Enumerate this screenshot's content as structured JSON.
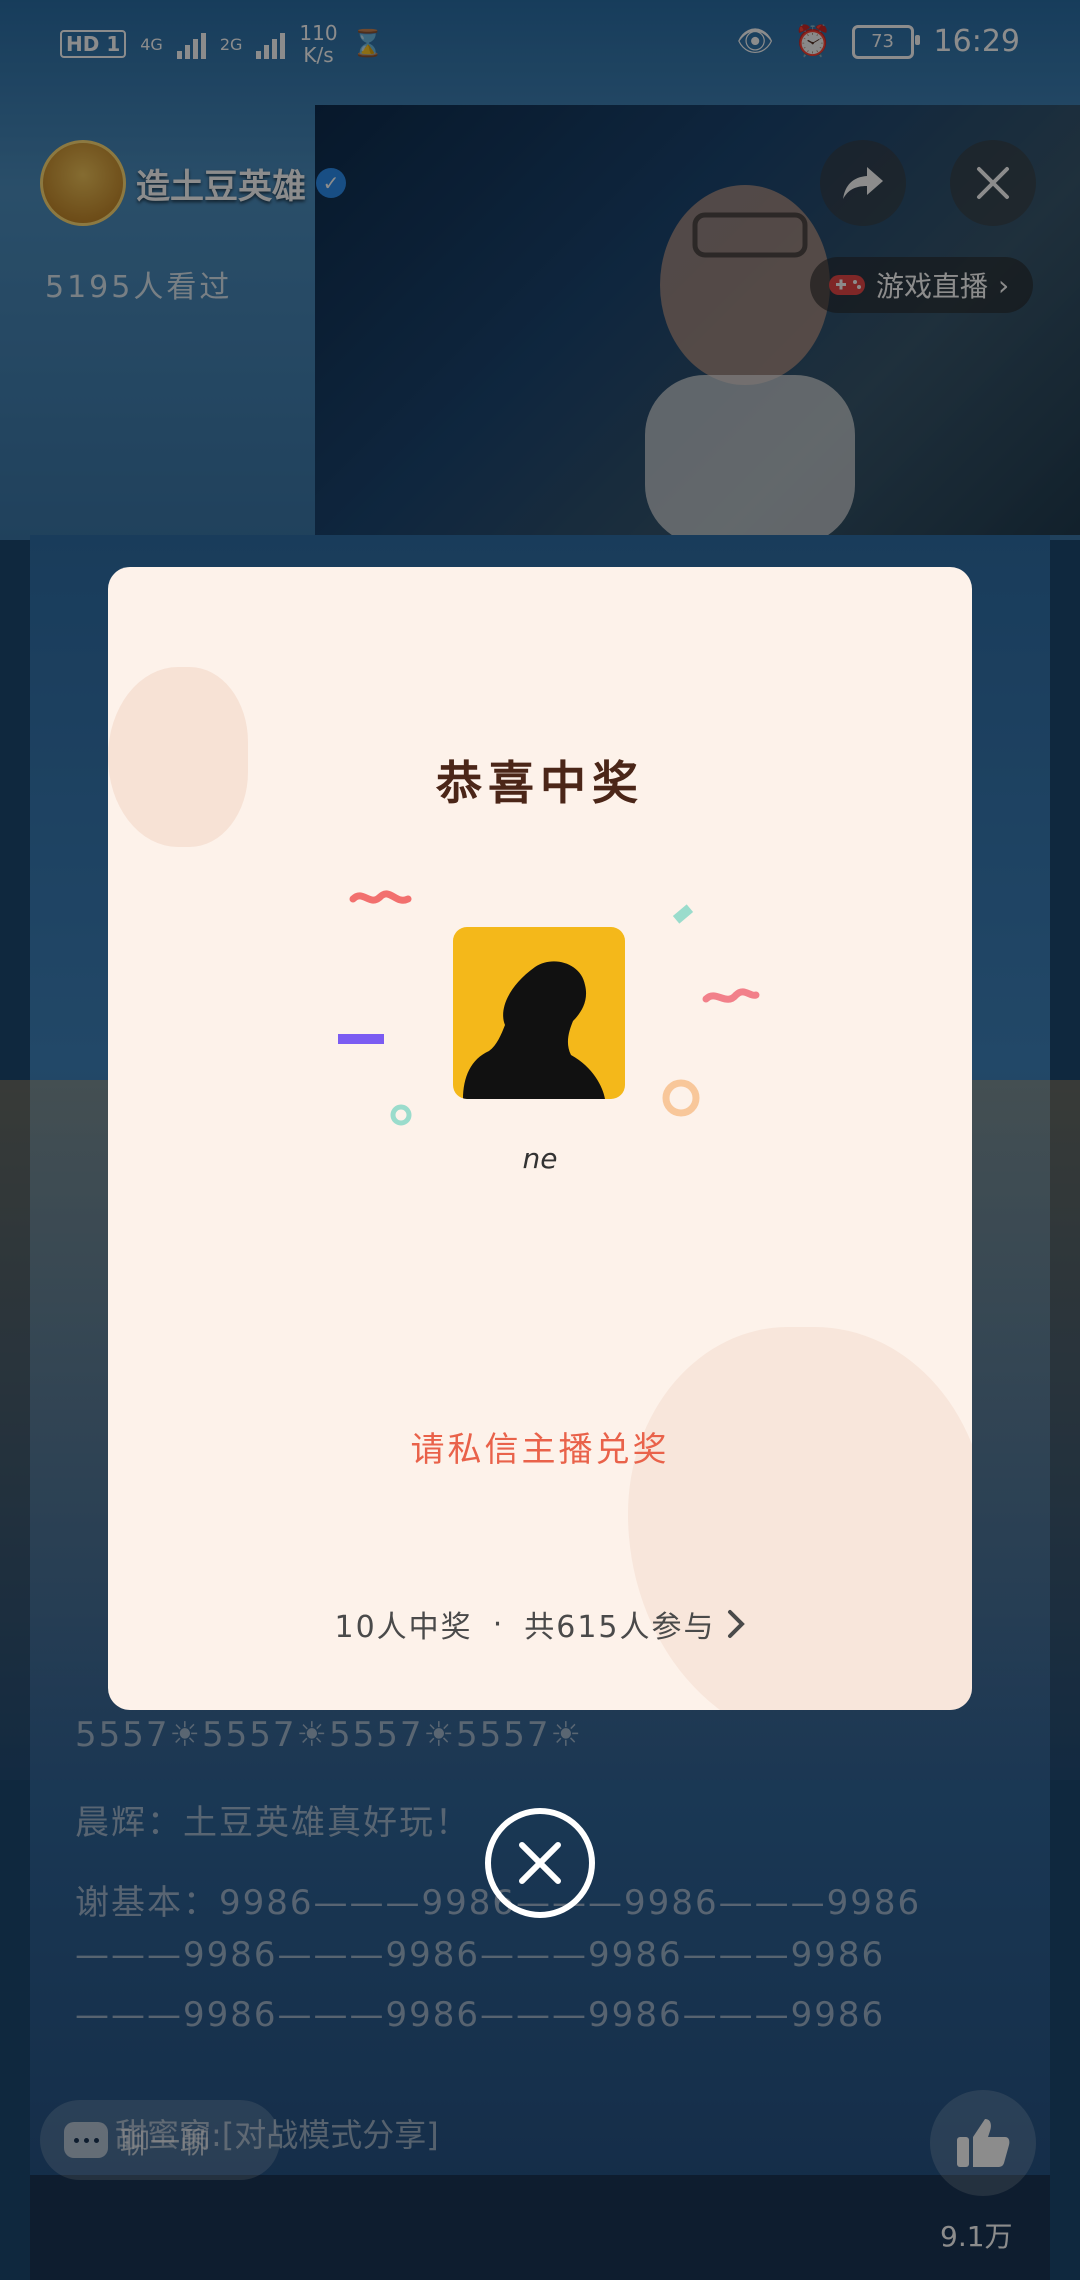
{
  "status_bar": {
    "hd_label": "HD",
    "sim_label": "1",
    "net1": "4G",
    "net2": "2G",
    "speed_value": "110",
    "speed_unit": "K/s",
    "battery": "73",
    "time": "16:29"
  },
  "stream": {
    "channel_name": "造土豆英雄",
    "viewers": "5195人看过",
    "category_label": "游戏直播",
    "chat_lines": [
      "5557☀5557☀5557☀5557☀",
      "晨辉：土豆英雄真好玩！",
      "谢基本：9986———9986———9986———9986",
      "———9986———9986———9986———9986",
      "———9986———9986———9986———9986"
    ],
    "comment_placeholder": "聊一聊",
    "shared_tag": "甜蜜窝:[对战模式分享]",
    "like_count": "9.1万"
  },
  "modal": {
    "title": "恭喜中奖",
    "winner_name": "ne",
    "contact_message": "请私信主播兑奖",
    "winners_count": "10人中奖",
    "separator": "·",
    "participants": "共615人参与"
  },
  "colors": {
    "modal_bg": "#fdf2ea",
    "title": "#4b2618",
    "accent_red": "#e9624a",
    "avatar_bg": "#f4b81a"
  }
}
